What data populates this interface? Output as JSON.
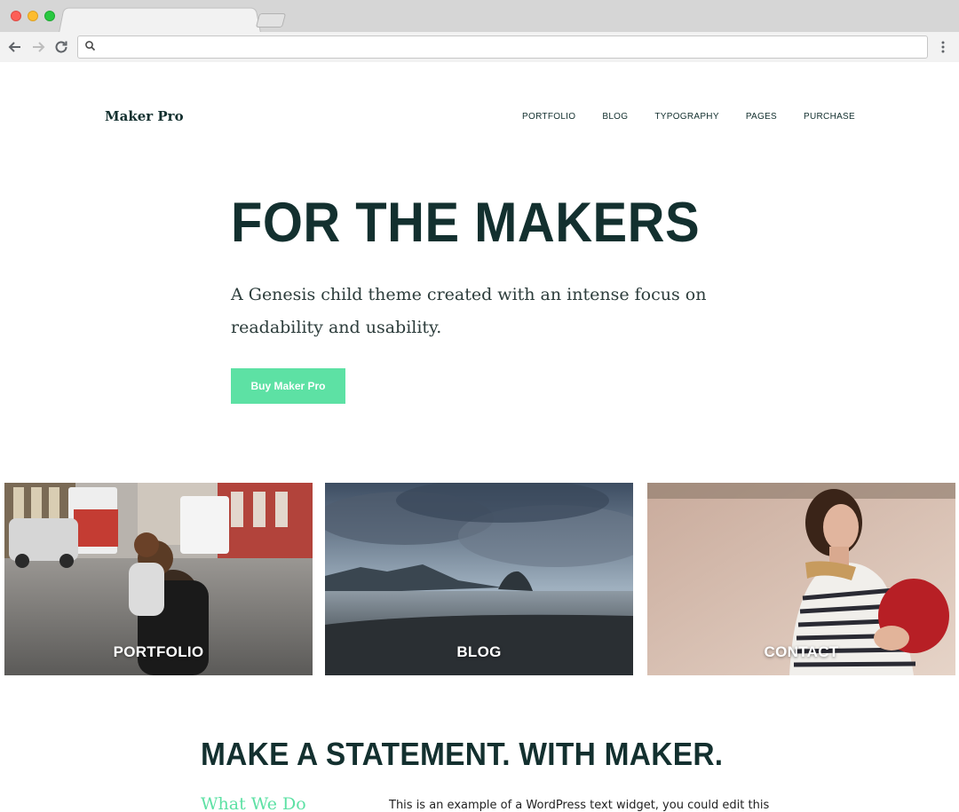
{
  "site": {
    "title": "Maker Pro",
    "nav": [
      "PORTFOLIO",
      "BLOG",
      "TYPOGRAPHY",
      "PAGES",
      "PURCHASE"
    ]
  },
  "hero": {
    "title": "FOR THE MAKERS",
    "description": "A Genesis child theme created with an intense focus on readability and usability.",
    "button_label": "Buy Maker Pro"
  },
  "tiles": [
    {
      "label": "PORTFOLIO"
    },
    {
      "label": "BLOG"
    },
    {
      "label": "CONTACT"
    }
  ],
  "section": {
    "title": "MAKE A STATEMENT. WITH MAKER.",
    "subtitle": "What We Do",
    "widget_text": "This is an example of a WordPress text widget, you could edit this"
  },
  "colors": {
    "accent": "#5de1a4",
    "heading": "#13302f"
  },
  "icons": {
    "back": "arrow-left-icon",
    "forward": "arrow-right-icon",
    "reload": "reload-icon",
    "search": "search-icon",
    "menu": "more-vertical-icon"
  }
}
